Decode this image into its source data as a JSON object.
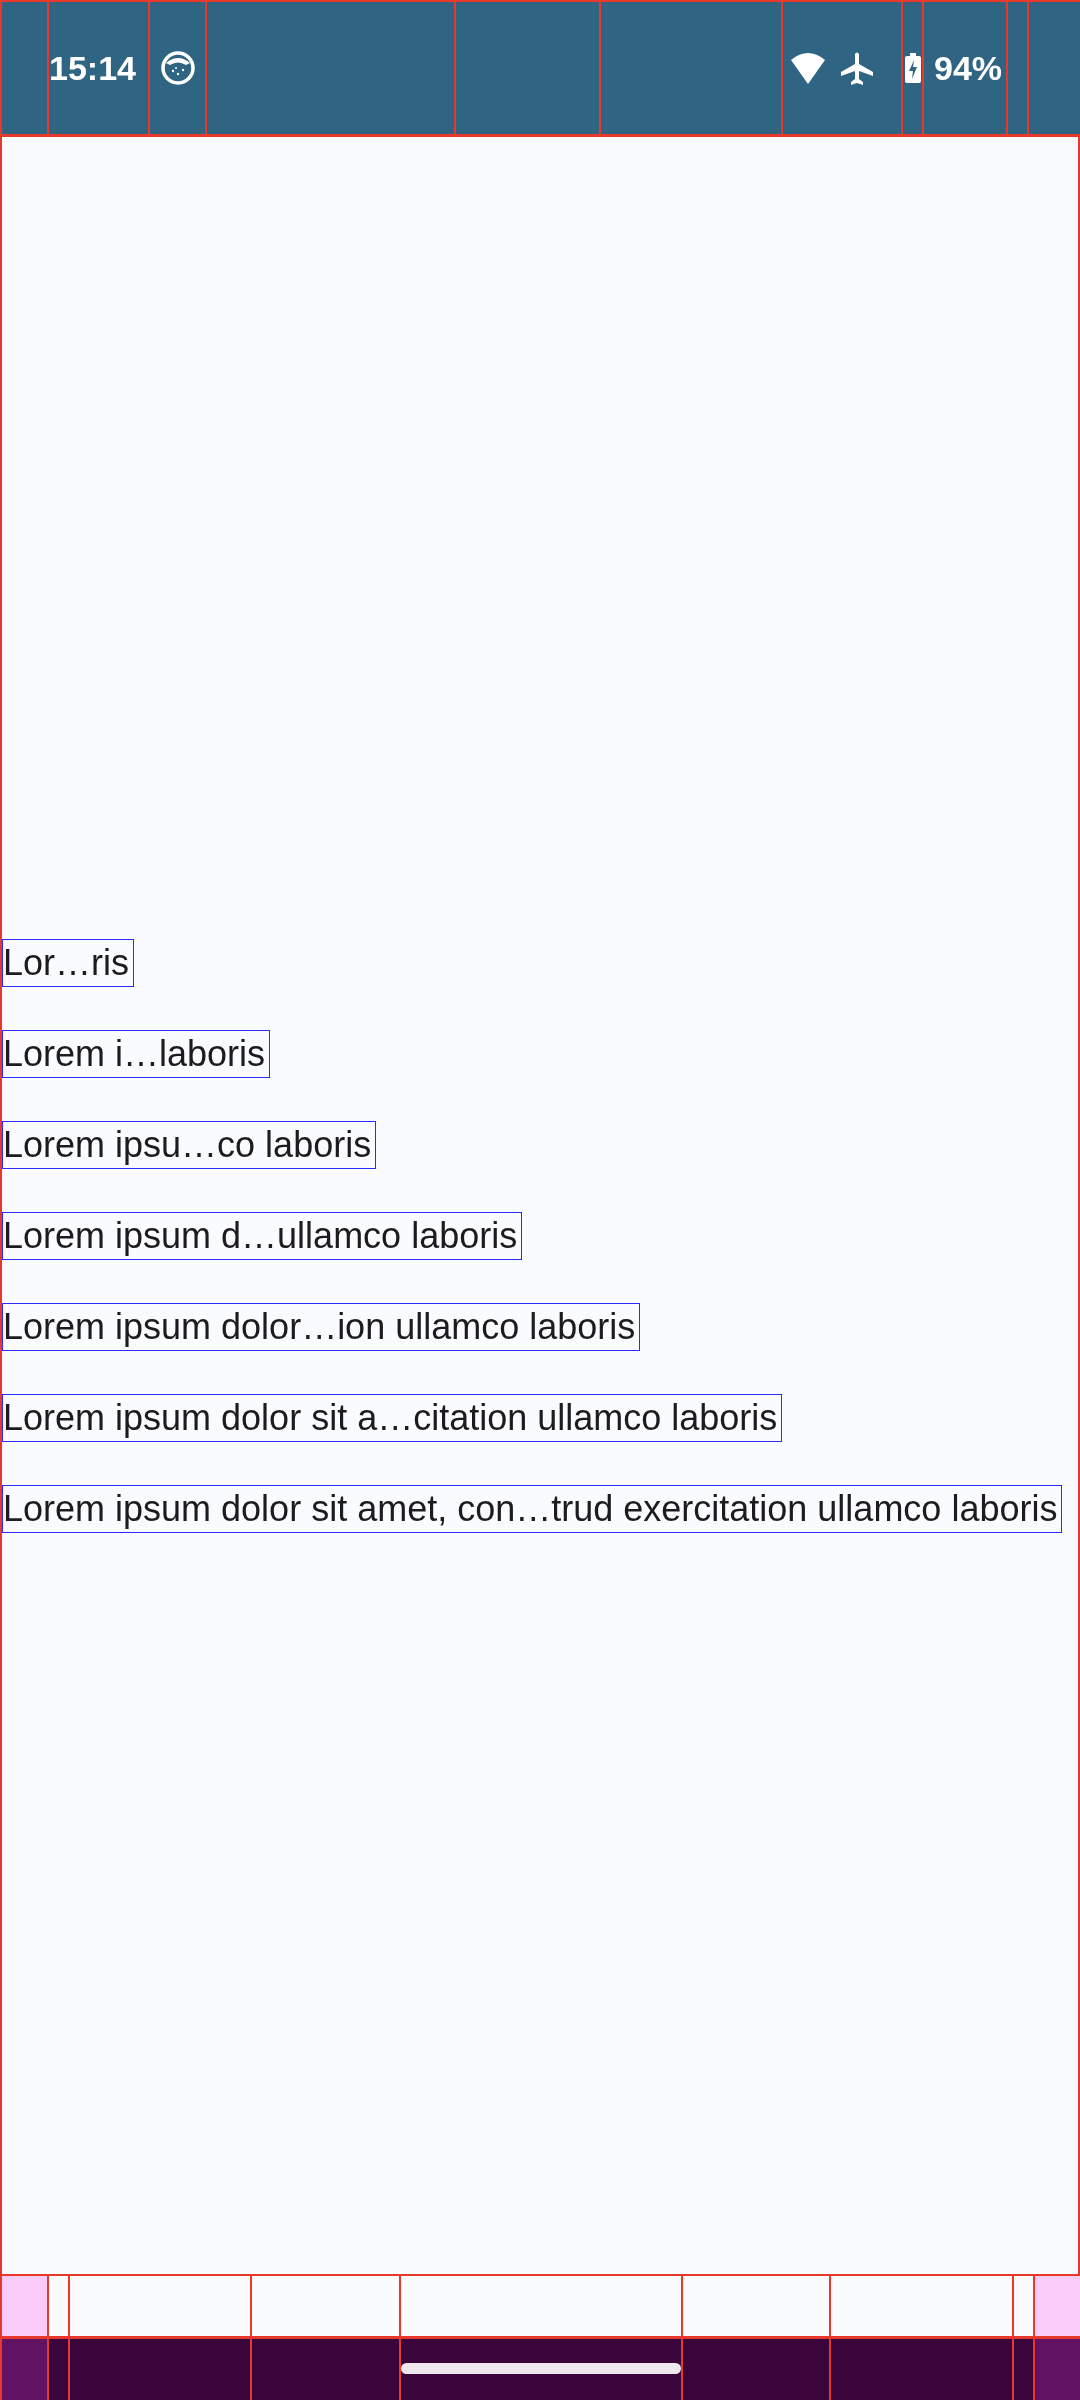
{
  "status_bar": {
    "time": "15:14",
    "battery": "94%"
  },
  "lines": [
    "Lor…ris",
    "Lorem i…laboris",
    "Lorem ipsu…co laboris",
    "Lorem ipsum d…ullamco laboris",
    "Lorem ipsum dolor…ion ullamco laboris",
    "Lorem ipsum dolor sit a…citation ullamco laboris",
    "Lorem ipsum dolor sit amet, con…trud exercitation ullamco laboris"
  ]
}
